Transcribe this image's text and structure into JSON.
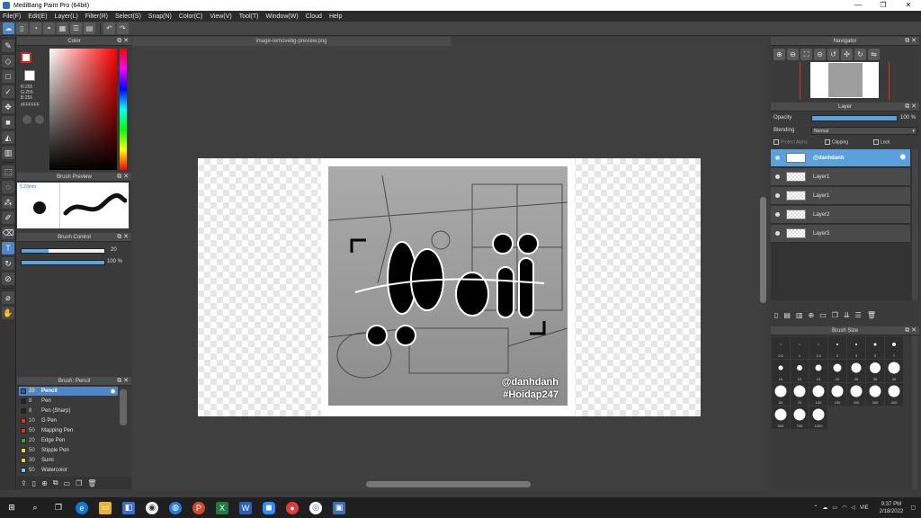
{
  "window": {
    "title": "MediBang Paint Pro (64bit)",
    "min": "—",
    "max": "❐",
    "close": "✕"
  },
  "menu": [
    "File(F)",
    "Edit(E)",
    "Layer(L)",
    "Filter(R)",
    "Select(S)",
    "Snap(N)",
    "Color(C)",
    "View(V)",
    "Tool(T)",
    "Window(W)",
    "Cloud",
    "Help"
  ],
  "colorPanel": {
    "title": "Color",
    "r": "R:255",
    "g": "G:255",
    "b": "B:255",
    "hex": "#FFFFFF"
  },
  "brushPreview": {
    "title": "Brush Preview",
    "size": "5.29mm"
  },
  "brushControl": {
    "title": "Brush Control",
    "size": "20",
    "opacity": "100 %",
    "size_fraction": 0.33,
    "opacity_fraction": 1.0
  },
  "brushList": {
    "title": "Brush: Pencil",
    "items": [
      {
        "size": "20",
        "name": "Pencil",
        "color": "#2a5fa5"
      },
      {
        "size": "8",
        "name": "Pen",
        "color": "#222222"
      },
      {
        "size": "8",
        "name": "Pen (Sharp)",
        "color": "#222222"
      },
      {
        "size": "10",
        "name": "G Pen",
        "color": "#e53030"
      },
      {
        "size": "50",
        "name": "Mapping Pen",
        "color": "#e53030"
      },
      {
        "size": "20",
        "name": "Edge Pen",
        "color": "#2eaa2e"
      },
      {
        "size": "50",
        "name": "Stipple Pen",
        "color": "#e8d43a"
      },
      {
        "size": "30",
        "name": "Sumi",
        "color": "#e8d43a"
      },
      {
        "size": "50",
        "name": "Watercolor",
        "color": "#6ec6f0"
      }
    ]
  },
  "canvas": {
    "tab": "image-removebg-preview.png",
    "watermark1": "@danhdanh",
    "watermark2": "#Hoidap247"
  },
  "navigator": {
    "title": "Navigator"
  },
  "layer": {
    "title": "Layer",
    "opacityLabel": "Opacity",
    "opacity": "100 %",
    "opacity_fraction": 1.0,
    "blendingLabel": "Blending",
    "blending": "Normal",
    "protectAlpha": "Protect Alpha",
    "clipping": "Clipping",
    "lock": "Lock",
    "items": [
      {
        "name": "@danhdanh"
      },
      {
        "name": "Layer1"
      },
      {
        "name": "Layer1"
      },
      {
        "name": "Layer2"
      },
      {
        "name": "Layer3"
      }
    ]
  },
  "brushSize": {
    "title": "Brush Size",
    "sizes": [
      "0.5",
      "1",
      "1.5",
      "2",
      "3",
      "5",
      "7",
      "10",
      "12",
      "15",
      "20",
      "25",
      "30",
      "40",
      "50",
      "70",
      "100",
      "150",
      "200",
      "300",
      "400",
      "500",
      "700",
      "1000"
    ]
  },
  "taskbar": {
    "lang": "VIE",
    "time": "9:37 PM",
    "date": "2/18/2022"
  }
}
